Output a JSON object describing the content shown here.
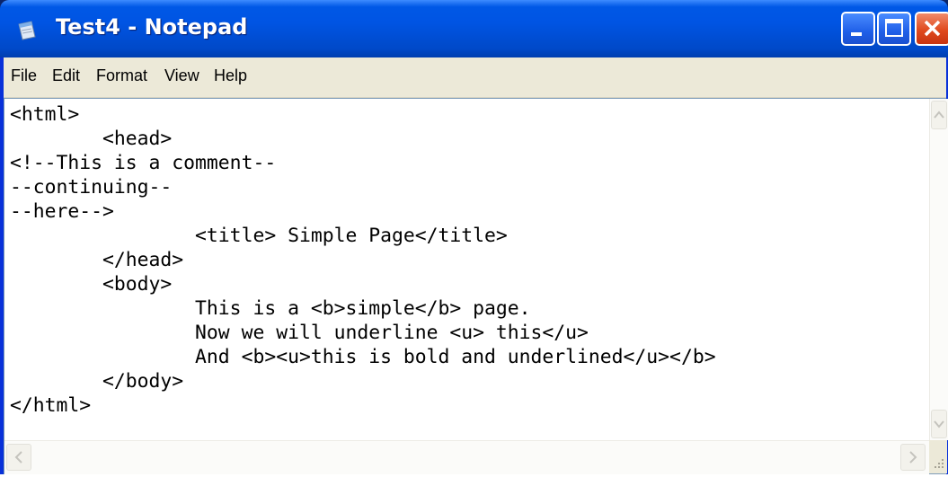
{
  "window": {
    "title": "Test4 - Notepad"
  },
  "menu": {
    "items": [
      "File",
      "Edit",
      "Format",
      "View",
      "Help"
    ]
  },
  "editor": {
    "lines": [
      "<html>",
      "        <head>",
      "<!--This is a comment--",
      "--continuing--",
      "--here-->",
      "                <title> Simple Page</title>",
      "        </head>",
      "        <body>",
      "                This is a <b>simple</b> page.",
      "                Now we will underline <u> this</u>",
      "                And <b><u>this is bold and underlined</u></b>",
      "        </body>",
      "</html>"
    ]
  },
  "icons": {
    "app": "notepad-icon",
    "minimize": "minimize-icon",
    "maximize": "maximize-icon",
    "close": "close-icon",
    "scroll_up": "chevron-up-icon",
    "scroll_down": "chevron-down-icon",
    "scroll_left": "chevron-left-icon",
    "scroll_right": "chevron-right-icon",
    "grip": "resize-grip-icon"
  },
  "colors": {
    "titlebar": "#0054e3",
    "close": "#e04a1e",
    "menubar": "#ece9d8"
  }
}
